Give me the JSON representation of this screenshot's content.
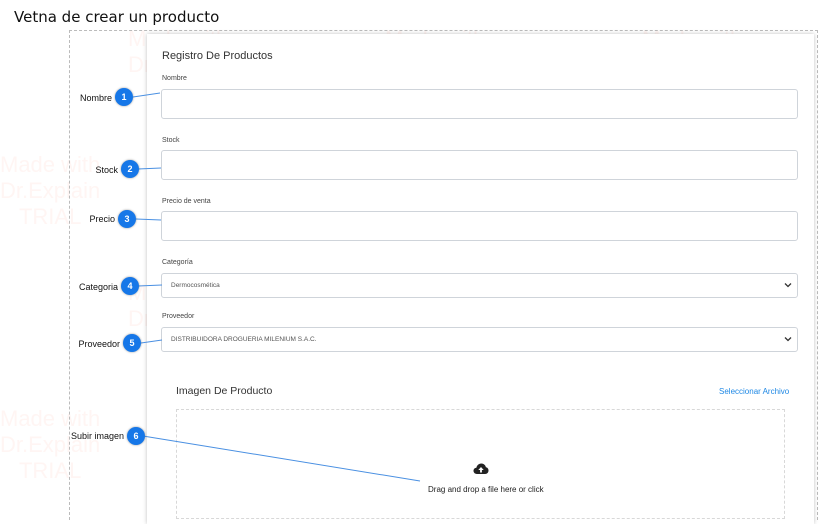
{
  "page": {
    "title": "Vetna de crear un producto"
  },
  "form": {
    "heading": "Registro De Productos",
    "fields": {
      "nombre": {
        "label": "Nombre",
        "value": ""
      },
      "stock": {
        "label": "Stock",
        "value": ""
      },
      "precio": {
        "label": "Precio de venta",
        "value": ""
      },
      "categoria": {
        "label": "Categoría",
        "selected": "Dermocosmética"
      },
      "proveedor": {
        "label": "Proveedor",
        "selected": "DISTRIBUIDORA DROGUERIA MILENIUM S.A.C."
      }
    },
    "image_section": {
      "title": "Imagen De Producto",
      "select_file_link": "Seleccionar Archivo",
      "dropzone_text": "Drag and drop a file here or click",
      "icon": "cloud-upload-icon"
    }
  },
  "callouts": [
    {
      "number": "1",
      "label": "Nombre"
    },
    {
      "number": "2",
      "label": "Stock"
    },
    {
      "number": "3",
      "label": "Precio"
    },
    {
      "number": "4",
      "label": "Categoria"
    },
    {
      "number": "5",
      "label": "Proveedor"
    },
    {
      "number": "6",
      "label": "Subir imagen"
    }
  ],
  "watermark": {
    "text": "Made with\nDr.Explain\nTRIAL"
  },
  "colors": {
    "badge": "#1677e8",
    "link": "#1e88e5",
    "callout_line": "#4a90e2"
  }
}
